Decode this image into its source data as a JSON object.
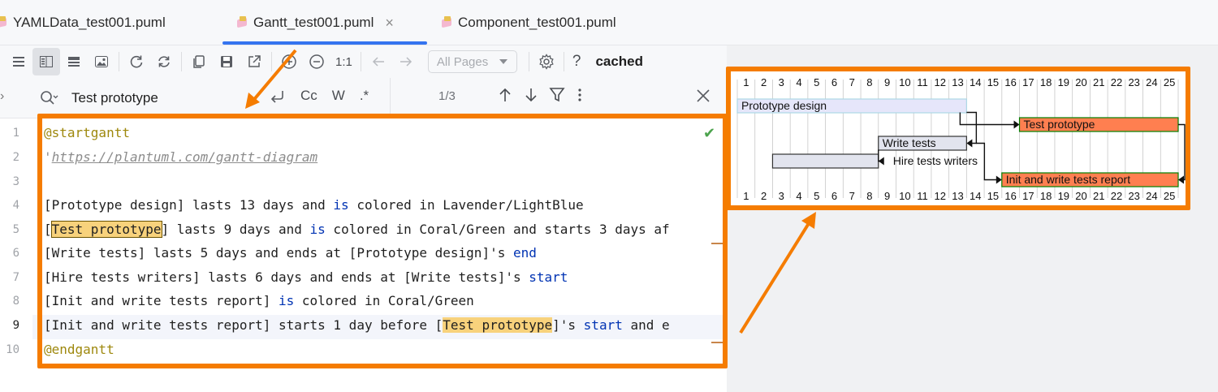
{
  "tabs": [
    {
      "label": "YAMLData_test001.puml"
    },
    {
      "label": "Gantt_test001.puml",
      "close": "×"
    },
    {
      "label": "Component_test001.puml"
    }
  ],
  "toolbar": {
    "zoom_reset": "1:1",
    "pages_select": "All Pages",
    "help": "?",
    "status": "cached"
  },
  "search": {
    "value": "Test prototype",
    "opt_regex_label": ".*",
    "opt_case_label": "Cc",
    "opt_word_label": "W",
    "match_count": "1/3"
  },
  "editor": {
    "lines": [
      {
        "n": "1"
      },
      {
        "n": "2"
      },
      {
        "n": "3"
      },
      {
        "n": "4"
      },
      {
        "n": "5"
      },
      {
        "n": "6"
      },
      {
        "n": "7"
      },
      {
        "n": "8"
      },
      {
        "n": "9"
      },
      {
        "n": "10"
      }
    ],
    "code": {
      "l1": "@startgantt",
      "l2_quote": "'",
      "l2_url": "https://plantuml.com/gantt-diagram",
      "l4a": "[Prototype design] lasts 13 days and ",
      "l4b": "is",
      "l4c": " colored in Lavender/LightBlue",
      "l5a": "[",
      "l5b": "Test prototype",
      "l5c": "] lasts 9 days and ",
      "l5d": "is",
      "l5e": " colored in Coral/Green and starts 3 days af",
      "l6a": "[Write tests] lasts 5 days and ends at [Prototype design]'s ",
      "l6b": "end",
      "l7a": "[Hire tests writers] lasts 6 days and ends at [Write tests]'s ",
      "l7b": "start",
      "l8a": "[Init and write tests report] ",
      "l8b": "is",
      "l8c": " colored in Coral/Green",
      "l9a": "[Init and write tests report] starts 1 day before [",
      "l9b": "Test prototype",
      "l9c": "]'s ",
      "l9d": "start",
      "l9e": " and e",
      "l10": "@endgantt"
    }
  },
  "gantt": {
    "days": [
      "1",
      "2",
      "3",
      "4",
      "5",
      "6",
      "7",
      "8",
      "9",
      "10",
      "11",
      "12",
      "13",
      "14",
      "15",
      "16",
      "17",
      "18",
      "19",
      "20",
      "21",
      "22",
      "23",
      "24",
      "25"
    ],
    "tasks": [
      {
        "name": "Prototype design",
        "start": 1,
        "end": 13,
        "fill": "#e6e6fa",
        "stroke": "#add8e6",
        "label_side": "inside"
      },
      {
        "name": "Test prototype",
        "start": 17,
        "end": 25,
        "fill": "#ff7f50",
        "stroke": "#008000",
        "label_side": "inside"
      },
      {
        "name": "Write tests",
        "start": 9,
        "end": 13,
        "fill": "#e2e4ee",
        "stroke": "#333333",
        "label_side": "inside"
      },
      {
        "name": "Hire tests writers",
        "start": 3,
        "end": 8,
        "fill": "#e2e4ee",
        "stroke": "#333333",
        "label_side": "right"
      },
      {
        "name": "Init and write tests report",
        "start": 16,
        "end": 25,
        "fill": "#ff7f50",
        "stroke": "#008000",
        "label_side": "inside"
      }
    ]
  },
  "colors": {
    "accent": "#3574f0",
    "annotation": "#f57c00",
    "highlight": "#f8d27c",
    "keyword": "#0033b3",
    "directive": "#9e880d"
  }
}
